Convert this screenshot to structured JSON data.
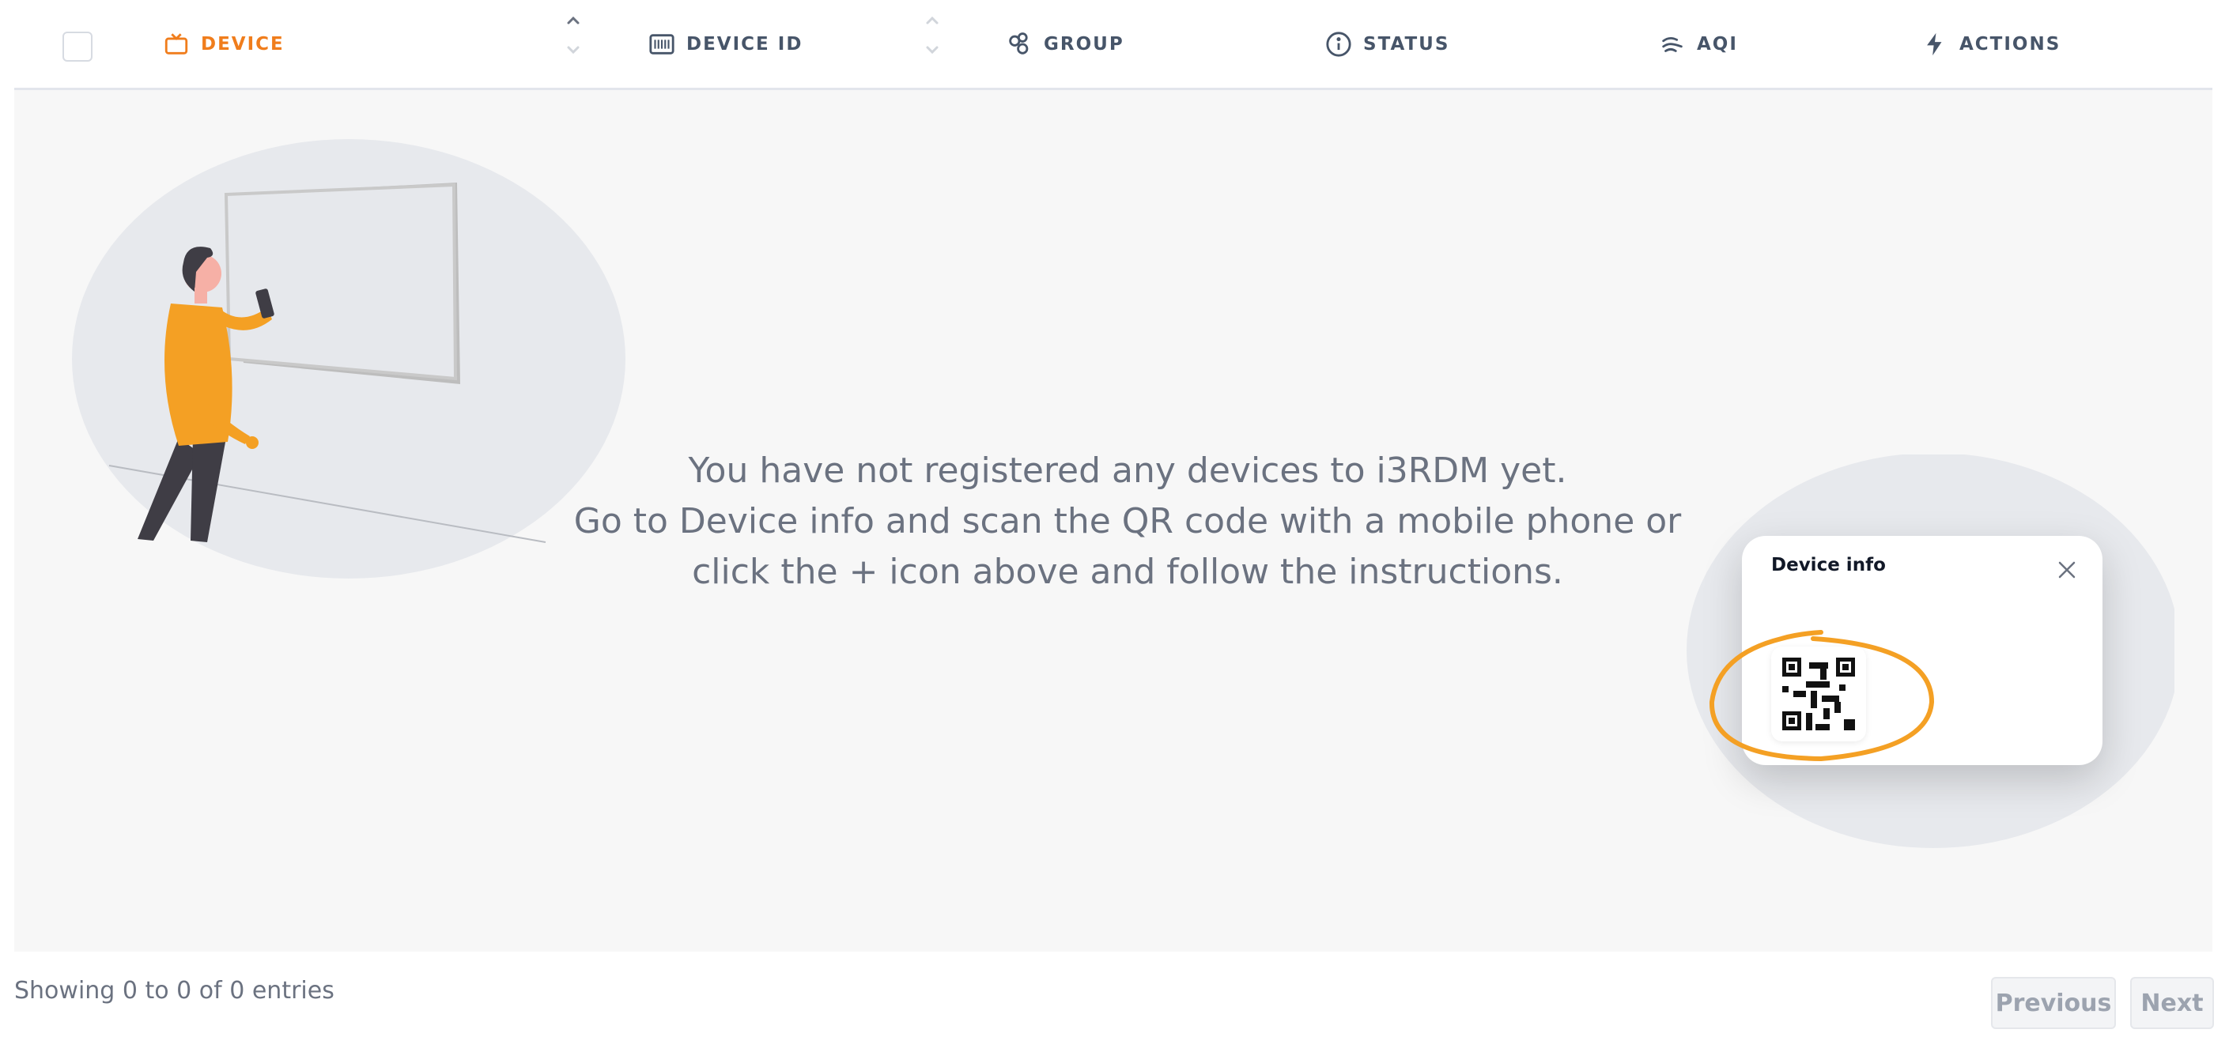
{
  "table": {
    "columns": [
      {
        "label": "DEVICE",
        "icon": "tv-icon",
        "active": true
      },
      {
        "label": "DEVICE ID",
        "icon": "barcode-icon"
      },
      {
        "label": "GROUP",
        "icon": "group-icon"
      },
      {
        "label": "STATUS",
        "icon": "info-icon"
      },
      {
        "label": "AQI",
        "icon": "wind-icon"
      },
      {
        "label": "ACTIONS",
        "icon": "bolt-icon"
      }
    ]
  },
  "empty_state": {
    "line1": "You have not registered any devices to i3RDM yet.",
    "line2": "Go to Device info and scan the QR code with a mobile phone or",
    "line3": "click the + icon above and follow the instructions."
  },
  "device_info_card": {
    "title": "Device info"
  },
  "footer": {
    "info": "Showing 0 to 0 of 0 entries",
    "previous_label": "Previous",
    "next_label": "Next"
  },
  "colors": {
    "accent": "#f07d1c",
    "header_text": "#475569",
    "empty_bg": "#f7f7f7",
    "illustration_orange": "#f4a024"
  }
}
